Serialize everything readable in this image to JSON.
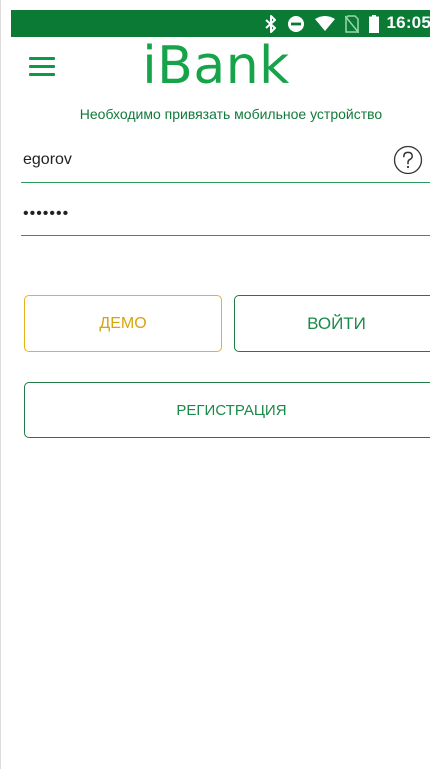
{
  "status_bar": {
    "time": "16:05",
    "icons": [
      "bluetooth-icon",
      "do-not-disturb-icon",
      "wifi-icon",
      "no-sim-icon",
      "battery-icon"
    ],
    "background_color": "#0a7a35"
  },
  "header": {
    "menu_icon": "hamburger-menu-icon",
    "title": "iBank",
    "title_color": "#16a34a"
  },
  "notice": {
    "text": "Необходимо привязать мобильное устройство"
  },
  "form": {
    "login": {
      "value": "egorov",
      "help_icon": "question-mark-icon"
    },
    "password": {
      "value": "•••••••"
    }
  },
  "buttons": {
    "demo_label": "ДЕМО",
    "login_label": "ВОЙТИ",
    "register_label": "РЕГИСТРАЦИЯ",
    "demo_color": "#e8b21a",
    "primary_color": "#1a8a49"
  }
}
